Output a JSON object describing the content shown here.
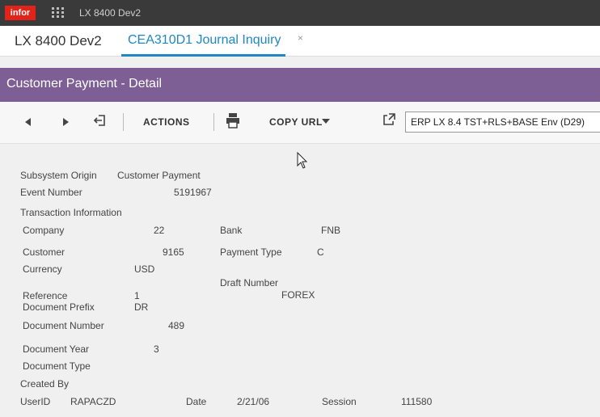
{
  "topbar": {
    "logo": "infor",
    "title": "LX 8400 Dev2"
  },
  "tabs": {
    "app_name": "LX 8400 Dev2",
    "active": "CEA310D1 Journal Inquiry",
    "close": "×"
  },
  "header": {
    "title": "Customer Payment - Detail"
  },
  "toolbar": {
    "actions": "ACTIONS",
    "copy_url": "COPY URL",
    "environment": "ERP LX 8.4 TST+RLS+BASE Env (D29)"
  },
  "detail": {
    "subsystem_origin_label": "Subsystem Origin",
    "subsystem_origin_value": "Customer Payment",
    "event_number_label": "Event Number",
    "event_number_value": "5191967",
    "transaction_info_label": "Transaction Information",
    "company_label": "Company",
    "company_value": "22",
    "bank_label": "Bank",
    "bank_value": "FNB",
    "customer_label": "Customer",
    "customer_value": "9165",
    "payment_type_label": "Payment Type",
    "payment_type_value": "C",
    "currency_label": "Currency",
    "currency_value": "USD",
    "draft_number_label": "Draft Number",
    "draft_number_value": "FOREX",
    "reference_label": "Reference",
    "reference_value": "1",
    "document_prefix_label": "Document Prefix",
    "document_prefix_value": "DR",
    "document_number_label": "Document Number",
    "document_number_value": "489",
    "document_year_label": "Document Year",
    "document_year_value": "3",
    "document_type_label": "Document Type",
    "created_by_label": "Created By",
    "userid_label": "UserID",
    "userid_value": "RAPACZD",
    "date_label": "Date",
    "date_value": "2/21/06",
    "session_label": "Session",
    "session_value": "111580"
  }
}
